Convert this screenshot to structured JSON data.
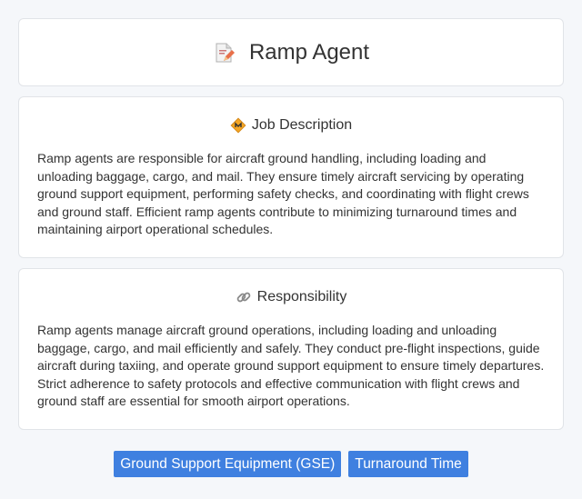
{
  "header": {
    "title": "Ramp Agent",
    "icon": "document-pencil-icon"
  },
  "job_description": {
    "heading": "Job Description",
    "icon": "diamond-badge-icon",
    "text": "Ramp agents are responsible for aircraft ground handling, including loading and unloading baggage, cargo, and mail. They ensure timely aircraft servicing by operating ground support equipment, performing safety checks, and coordinating with flight crews and ground staff. Efficient ramp agents contribute to minimizing turnaround times and maintaining airport operational schedules."
  },
  "responsibility": {
    "heading": "Responsibility",
    "icon": "link-icon",
    "text": "Ramp agents manage aircraft ground operations, including loading and unloading baggage, cargo, and mail efficiently and safely. They conduct pre-flight inspections, guide aircraft during taxiing, and operate ground support equipment to ensure timely departures. Strict adherence to safety protocols and effective communication with flight crews and ground staff are essential for smooth airport operations."
  },
  "tags": [
    "Ground Support Equipment (GSE)",
    "Turnaround Time"
  ],
  "colors": {
    "tag_bg": "#3f80e0",
    "page_bg": "#f5f7fa"
  }
}
